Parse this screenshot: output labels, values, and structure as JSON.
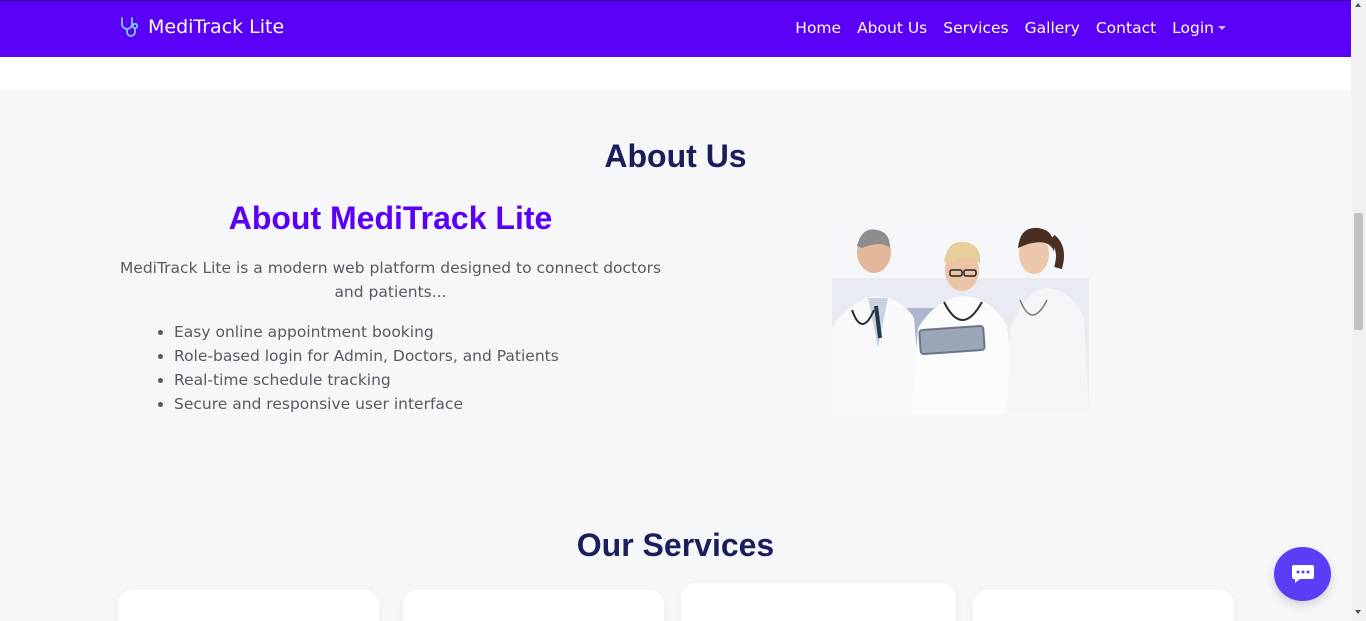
{
  "brand": {
    "name": "MediTrack Lite",
    "icon": "stethoscope-icon"
  },
  "nav": {
    "items": [
      "Home",
      "About Us",
      "Services",
      "Gallery",
      "Contact"
    ],
    "login": "Login"
  },
  "about": {
    "title": "About Us",
    "subtitle": "About MediTrack Lite",
    "description": "MediTrack Lite is a modern web platform designed to connect doctors and patients...",
    "features": [
      "Easy online appointment booking",
      "Role-based login for Admin, Doctors, and Patients",
      "Real-time schedule tracking",
      "Secure and responsive user interface"
    ]
  },
  "services": {
    "title": "Our Services"
  },
  "chat": {
    "icon": "chat-bubble-icon"
  },
  "colors": {
    "primary": "#5b00f7",
    "heading": "#1a1f5c",
    "chat": "#5b3df5"
  }
}
